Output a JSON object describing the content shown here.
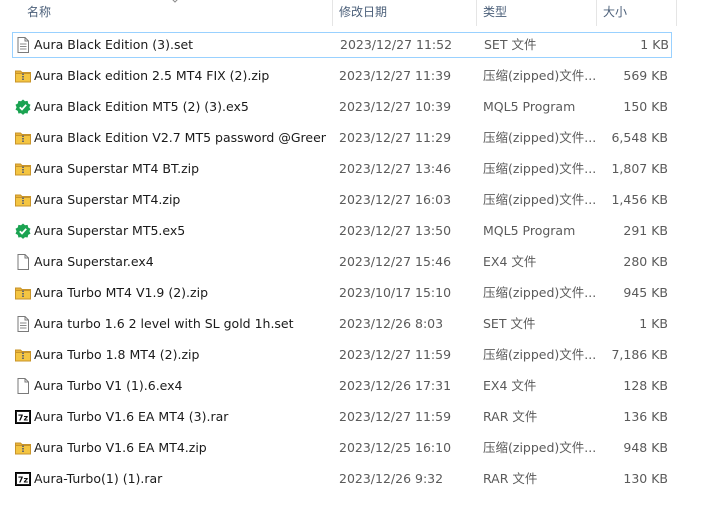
{
  "columns": {
    "name": "名称",
    "date": "修改日期",
    "type": "类型",
    "size": "大小"
  },
  "files": [
    {
      "icon": "text-file-icon",
      "name": "Aura Black Edition (3).set",
      "date": "2023/12/27 11:52",
      "type": "SET 文件",
      "size": "1 KB",
      "selected": true
    },
    {
      "icon": "zip-folder-icon",
      "name": "Aura Black edition 2.5 MT4 FIX (2).zip",
      "date": "2023/12/27 11:39",
      "type": "压缩(zipped)文件...",
      "size": "569 KB"
    },
    {
      "icon": "mql5-program-icon",
      "name": "Aura Black Edition MT5 (2) (3).ex5",
      "date": "2023/12/27 10:39",
      "type": "MQL5 Program",
      "size": "150 KB"
    },
    {
      "icon": "zip-folder-icon",
      "name": "Aura Black Edition V2.7 MT5 password @Green...",
      "date": "2023/12/27 11:29",
      "type": "压缩(zipped)文件...",
      "size": "6,548 KB"
    },
    {
      "icon": "zip-folder-icon",
      "name": "Aura Superstar MT4 BT.zip",
      "date": "2023/12/27 13:46",
      "type": "压缩(zipped)文件...",
      "size": "1,807 KB"
    },
    {
      "icon": "zip-folder-icon",
      "name": "Aura Superstar MT4.zip",
      "date": "2023/12/27 16:03",
      "type": "压缩(zipped)文件...",
      "size": "1,456 KB"
    },
    {
      "icon": "mql5-program-icon",
      "name": "Aura Superstar MT5.ex5",
      "date": "2023/12/27 13:50",
      "type": "MQL5 Program",
      "size": "291 KB"
    },
    {
      "icon": "blank-file-icon",
      "name": "Aura Superstar.ex4",
      "date": "2023/12/27 15:46",
      "type": "EX4 文件",
      "size": "280 KB"
    },
    {
      "icon": "zip-folder-icon",
      "name": "Aura Turbo  MT4 V1.9 (2).zip",
      "date": "2023/10/17 15:10",
      "type": "压缩(zipped)文件...",
      "size": "945 KB"
    },
    {
      "icon": "text-file-icon",
      "name": "Aura turbo 1.6 2 level with SL gold 1h.set",
      "date": "2023/12/26 8:03",
      "type": "SET 文件",
      "size": "1 KB"
    },
    {
      "icon": "zip-folder-icon",
      "name": "Aura Turbo 1.8 MT4 (2).zip",
      "date": "2023/12/27 11:59",
      "type": "压缩(zipped)文件...",
      "size": "7,186 KB"
    },
    {
      "icon": "blank-file-icon",
      "name": "Aura Turbo V1 (1).6.ex4",
      "date": "2023/12/26 17:31",
      "type": "EX4 文件",
      "size": "128 KB"
    },
    {
      "icon": "rar-7z-icon",
      "name": "Aura Turbo V1.6 EA MT4 (3).rar",
      "date": "2023/12/27 11:59",
      "type": "RAR 文件",
      "size": "136 KB"
    },
    {
      "icon": "zip-folder-icon",
      "name": "Aura Turbo V1.6 EA MT4.zip",
      "date": "2023/12/25 16:10",
      "type": "压缩(zipped)文件...",
      "size": "948 KB"
    },
    {
      "icon": "rar-7z-icon",
      "name": "Aura-Turbo(1) (1).rar",
      "date": "2023/12/26 9:32",
      "type": "RAR 文件",
      "size": "130 KB"
    }
  ],
  "icon_labels": {
    "rar": "7z"
  },
  "colors": {
    "selection_border": "#99d1ff",
    "zip_folder": "#f4c542",
    "mql5_green": "#1aa351"
  }
}
